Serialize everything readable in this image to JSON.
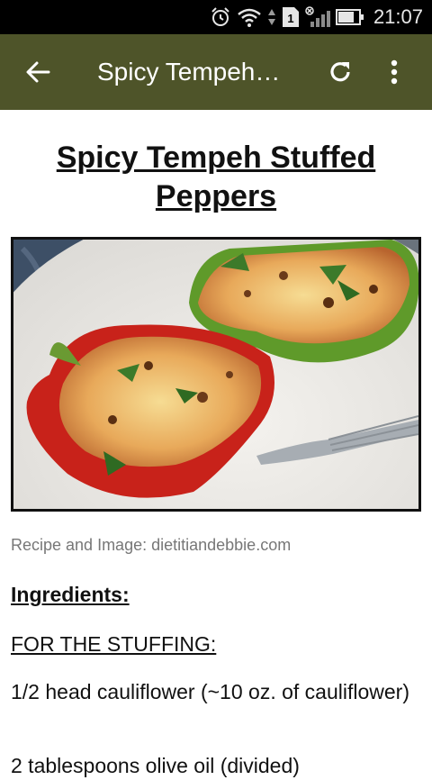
{
  "status_bar": {
    "time": "21:07",
    "sim_label": "1"
  },
  "app_bar": {
    "title": "Spicy Tempeh…"
  },
  "recipe": {
    "title": "Spicy Tempeh Stuffed Peppers",
    "credit": "Recipe and Image: dietitiandebbie.com",
    "ingredients_heading": "Ingredients:",
    "stuffing_heading": "FOR THE STUFFING:",
    "items": [
      "1/2 head cauliflower (~10 oz. of cauliflower)",
      "2 tablespoons olive oil (divided)"
    ]
  }
}
